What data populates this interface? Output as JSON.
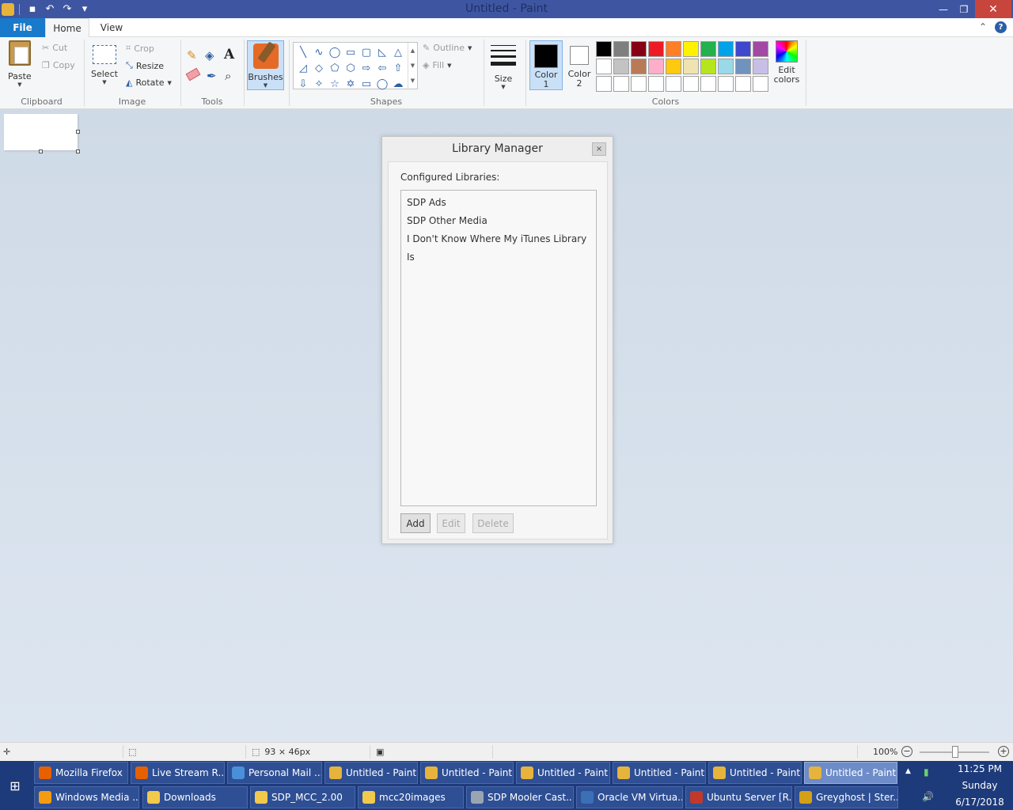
{
  "window": {
    "title": "Untitled - Paint",
    "min_glyph": "—",
    "max_glyph": "❐",
    "close_glyph": "✕"
  },
  "qat": {
    "save_glyph": "▪",
    "undo_glyph": "↶",
    "redo_glyph": "↷",
    "custom_glyph": "▾"
  },
  "tabs": {
    "file": "File",
    "home": "Home",
    "view": "View",
    "help": "?"
  },
  "ribbon": {
    "clipboard": {
      "label": "Clipboard",
      "paste": "Paste",
      "cut": "Cut",
      "copy": "Copy"
    },
    "image": {
      "label": "Image",
      "select": "Select",
      "crop": "Crop",
      "resize": "Resize",
      "rotate": "Rotate"
    },
    "tools": {
      "label": "Tools",
      "text_glyph": "A"
    },
    "brushes": {
      "label": "Brushes"
    },
    "shapes": {
      "label": "Shapes",
      "outline": "Outline",
      "fill": "Fill",
      "glyphs": [
        "╲",
        "∿",
        "◯",
        "▭",
        "▢",
        "◺",
        "△",
        "◿",
        "◇",
        "⬠",
        "⬡",
        "⇨",
        "⇦",
        "⇧",
        "⇩",
        "✧",
        "☆",
        "✡",
        "▭",
        "◯",
        "☁"
      ]
    },
    "size": {
      "label": "Size"
    },
    "colors": {
      "label": "Colors",
      "color1": "Color 1",
      "color2": "Color 2",
      "edit": "Edit colors",
      "color1_value": "#000000",
      "color2_value": "#ffffff",
      "palette": [
        "#000000",
        "#7f7f7f",
        "#880015",
        "#ed1c24",
        "#ff7f27",
        "#fff200",
        "#22b14c",
        "#00a2e8",
        "#3f48cc",
        "#a349a4",
        "#ffffff",
        "#c3c3c3",
        "#b97a57",
        "#ffaec9",
        "#ffc90e",
        "#efe4b0",
        "#b5e61d",
        "#99d9ea",
        "#7092be",
        "#c8bfe7",
        "#ffffff",
        "#ffffff",
        "#ffffff",
        "#ffffff",
        "#ffffff",
        "#ffffff",
        "#ffffff",
        "#ffffff",
        "#ffffff",
        "#ffffff"
      ]
    }
  },
  "dialog": {
    "title": "Library Manager",
    "close_glyph": "×",
    "label": "Configured Libraries:",
    "libraries": [
      "SDP Ads",
      "SDP Other Media",
      "I Don't Know Where My iTunes Library Is"
    ],
    "add": "Add",
    "edit": "Edit",
    "delete": "Delete"
  },
  "statusbar": {
    "move_glyph": "✛",
    "select_glyph": "⬚",
    "size_glyph": "⬚",
    "dimensions": "93 × 46px",
    "disk_glyph": "▣",
    "zoom": "100%",
    "zoom_out": "−",
    "zoom_in": "+"
  },
  "taskbar": {
    "start_glyph": "⊞",
    "row1": [
      {
        "label": "Mozilla Firefox",
        "icon_color": "#e66000"
      },
      {
        "label": "Live Stream R...",
        "icon_color": "#e66000"
      },
      {
        "label": "Personal Mail ...",
        "icon_color": "#4a90d9"
      },
      {
        "label": "Untitled - Paint",
        "icon_color": "#e6b33c"
      },
      {
        "label": "Untitled - Paint",
        "icon_color": "#e6b33c"
      },
      {
        "label": "Untitled - Paint",
        "icon_color": "#e6b33c"
      },
      {
        "label": "Untitled - Paint",
        "icon_color": "#e6b33c"
      },
      {
        "label": "Untitled - Paint",
        "icon_color": "#e6b33c"
      },
      {
        "label": "Untitled - Paint",
        "icon_color": "#e6b33c"
      }
    ],
    "row2": [
      {
        "label": "Windows Media ...",
        "icon_color": "#f39c12"
      },
      {
        "label": "Downloads",
        "icon_color": "#f2c94c"
      },
      {
        "label": "SDP_MCC_2.00",
        "icon_color": "#f2c94c"
      },
      {
        "label": "mcc20images",
        "icon_color": "#f2c94c"
      },
      {
        "label": "SDP Mooler Cast...",
        "icon_color": "#9aa5b1"
      },
      {
        "label": "Oracle VM Virtua...",
        "icon_color": "#3b6fb6"
      },
      {
        "label": "Ubuntu Server [R...",
        "icon_color": "#c0392b"
      },
      {
        "label": "Greyghost | Ster...",
        "icon_color": "#d4a017"
      }
    ],
    "tray": {
      "up_glyph": "▲",
      "volume_glyph": "🔊",
      "net_glyph": "▮"
    },
    "clock": {
      "time": "11:25 PM",
      "day": "Sunday",
      "date": "6/17/2018"
    }
  }
}
